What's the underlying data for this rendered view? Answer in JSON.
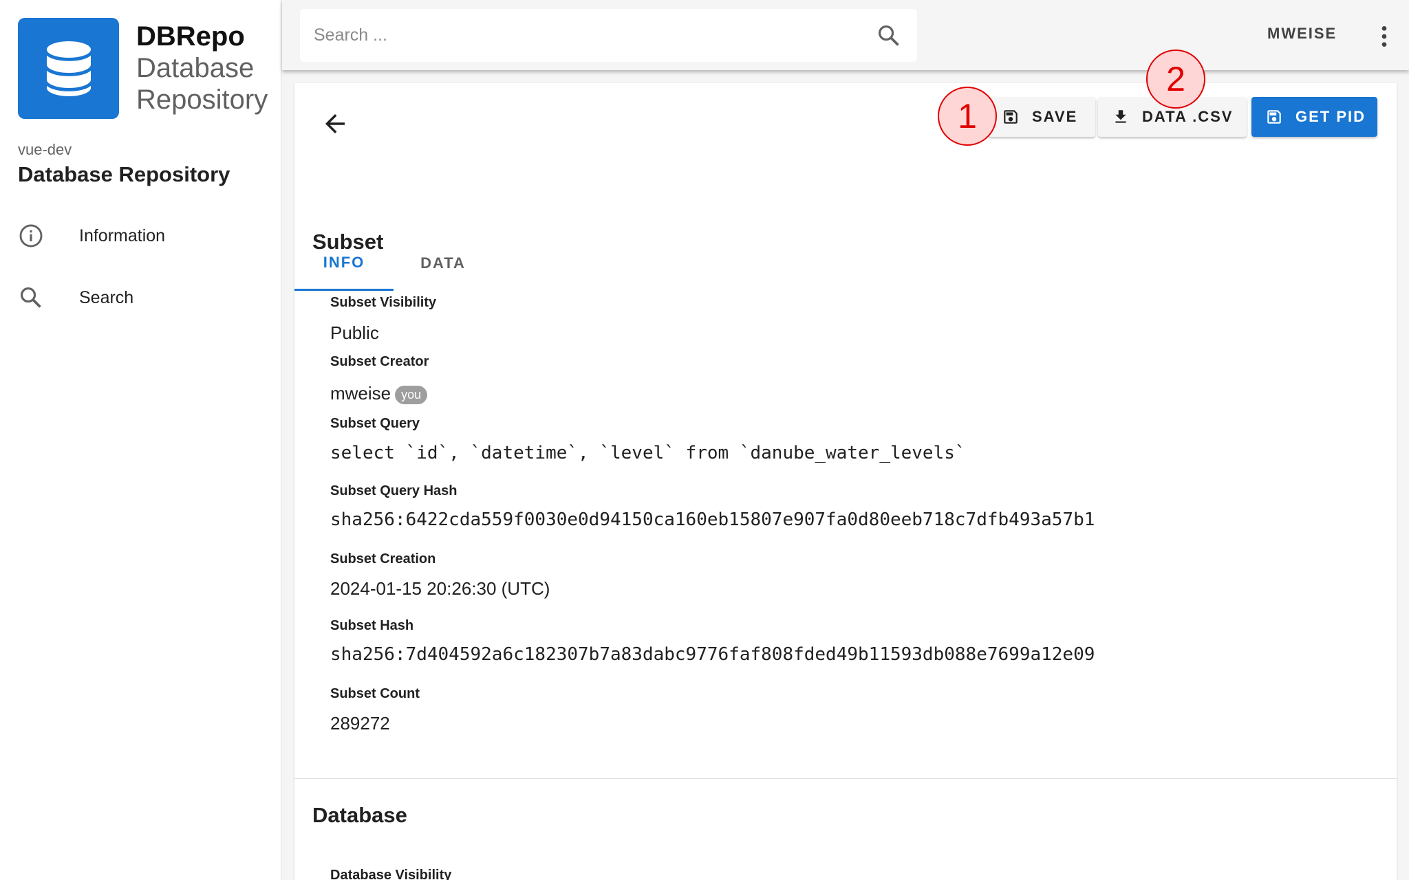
{
  "sidebar": {
    "brand_name": "DBRepo",
    "brand_sub_1": "Database",
    "brand_sub_2": "Repository",
    "instance": "vue-dev",
    "instance_title": "Database Repository",
    "items": [
      {
        "label": "Information",
        "icon": "info-icon"
      },
      {
        "label": "Search",
        "icon": "search-icon"
      }
    ]
  },
  "appbar": {
    "search_placeholder": "Search ...",
    "user": "MWEISE"
  },
  "toolbar": {
    "save_label": "SAVE",
    "csv_label": "DATA .CSV",
    "pid_label": "GET PID"
  },
  "annotations": {
    "marker_1": "1",
    "marker_2": "2"
  },
  "tabs": [
    {
      "label": "INFO",
      "active": true
    },
    {
      "label": "DATA",
      "active": false
    }
  ],
  "subset": {
    "title": "Subset",
    "visibility_label": "Subset Visibility",
    "visibility_value": "Public",
    "creator_label": "Subset Creator",
    "creator_value": "mweise",
    "creator_chip": "you",
    "query_label": "Subset Query",
    "query_value": "select `id`, `datetime`, `level` from `danube_water_levels`",
    "query_hash_label": "Subset Query Hash",
    "query_hash_value": "sha256:6422cda559f0030e0d94150ca160eb15807e907fa0d80eeb718c7dfb493a57b1",
    "creation_label": "Subset Creation",
    "creation_value": "2024-01-15 20:26:30 (UTC)",
    "hash_label": "Subset Hash",
    "hash_value": "sha256:7d404592a6c182307b7a83dabc9776faf808fded49b11593db088e7699a12e09",
    "count_label": "Subset Count",
    "count_value": "289272"
  },
  "database": {
    "title": "Database",
    "visibility_label": "Database Visibility"
  },
  "colors": {
    "primary": "#1976d2",
    "marker_red": "#e00000",
    "marker_fill": "#ffd6d6"
  }
}
